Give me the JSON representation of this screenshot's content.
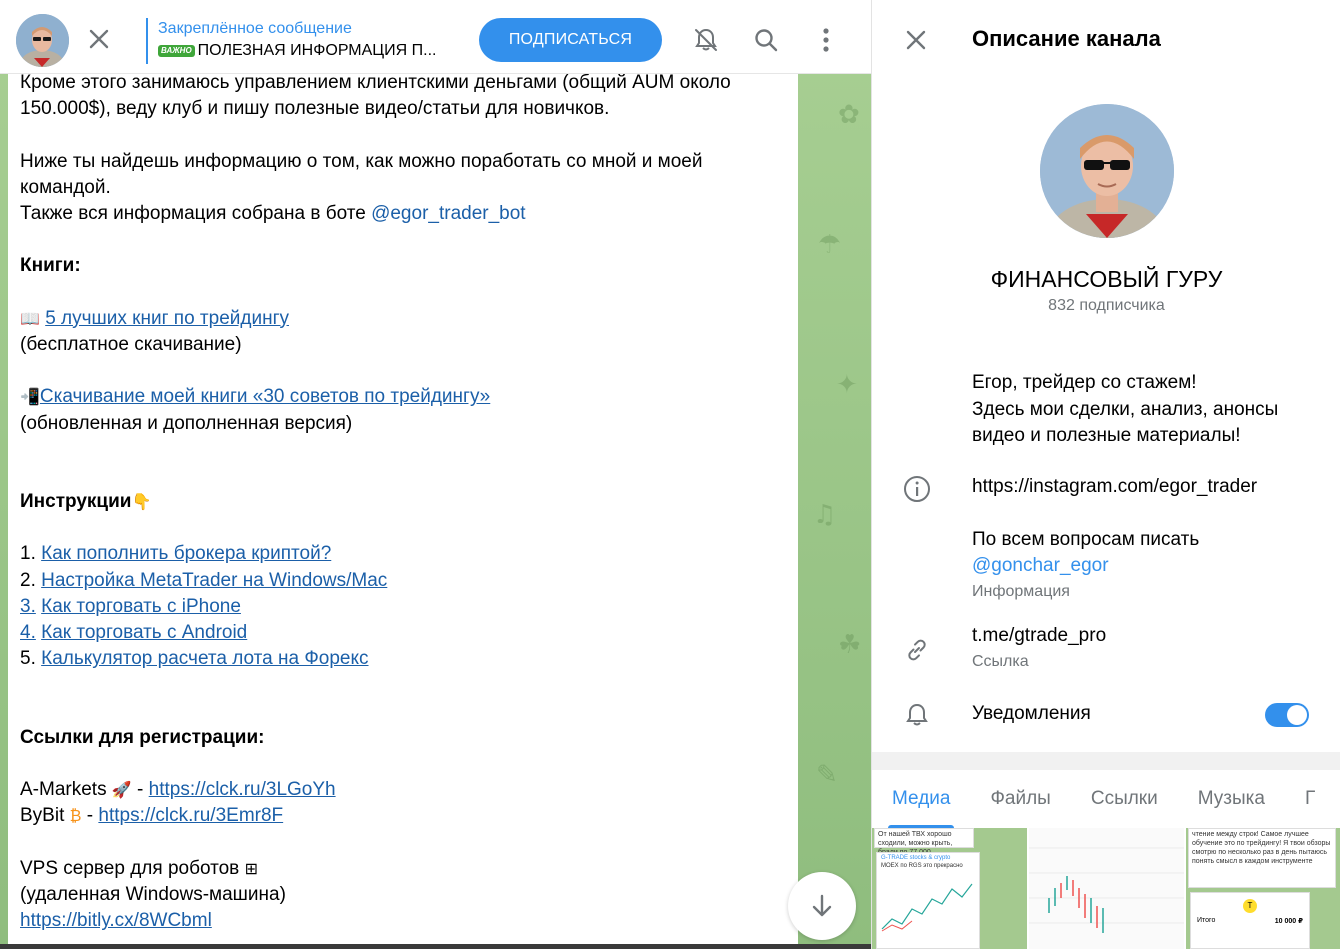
{
  "header": {
    "pinned_title": "Закреплённое сообщение",
    "pinned_badge": "ВАЖНО",
    "pinned_text": "ПОЛЕЗНАЯ ИНФОРМАЦИЯ П...",
    "subscribe_label": "ПОДПИСАТЬСЯ"
  },
  "message": {
    "intro_line": "Кроме этого занимаюсь управлением клиентскими деньгами (общий AUM около 150.000$), веду клуб и пишу полезные видео/статьи для новичков.",
    "below_line": "Ниже ты найдешь информацию о том, как можно поработать со мной и моей командой.",
    "bot_line_prefix": "Также вся информация собрана в боте ",
    "bot_mention": "@egor_trader_bot",
    "books_heading": "Книги:",
    "book1_link": "5 лучших книг по трейдингу",
    "book1_note": "(бесплатное скачивание)",
    "book2_link": "Скачивание моей книги «30 советов по трейдингу»",
    "book2_note": "(обновленная и дополненная версия)",
    "instructions_heading": "Инструкции",
    "instructions": [
      {
        "num": "1. ",
        "text": "Как пополнить брокера криптой?",
        "num_link": false
      },
      {
        "num": "2. ",
        "text": "Настройка MetaTrader на Windows/Mac",
        "num_link": false
      },
      {
        "num": "3.",
        "text": "Как торговать с iPhone",
        "num_link": true
      },
      {
        "num": "4.",
        "text": "Как торговать с Android",
        "num_link": true
      },
      {
        "num": "5. ",
        "text": "Калькулятор расчета лота на Форекс",
        "num_link": false
      }
    ],
    "reg_heading": "Ссылки для регистрации:",
    "reg1_name": "A-Markets",
    "reg1_url": "https://clck.ru/3LGoYh",
    "reg2_name": "ByBit",
    "reg2_url": "https://clck.ru/3Emr8F",
    "vps_line": "VPS сервер для роботов",
    "vps_note": "(удаленная Windows-машина)",
    "vps_url": "https://bitly.cx/8WCbml"
  },
  "panel": {
    "title": "Описание канала",
    "channel_name": "ФИНАНСОВЫЙ ГУРУ",
    "subscribers": "832 подписчика",
    "description": [
      "Егор, трейдер со стажем!",
      "Здесь мои сделки, анализ, анонсы",
      "видео и полезные материалы!"
    ],
    "info_url": "https://instagram.com/egor_trader",
    "contact_line": "По всем вопросам писать",
    "contact_mention": "@gonchar_egor",
    "info_label": "Информация",
    "link_value": "t.me/gtrade_pro",
    "link_label": "Ссылка",
    "notifications_label": "Уведомления",
    "notifications_on": true,
    "tabs": [
      "Медиа",
      "Файлы",
      "Ссылки",
      "Музыка",
      "Г"
    ],
    "media": [
      {
        "text": "От нашей ТВХ хорошо сходили, можно крыть, брали по 77.000",
        "inner": "G-TRADE stocks & crypto",
        "inner2": "MOEX по RGS это прекрасно"
      },
      {
        "text": ""
      },
      {
        "text": "чтение между строк! Самое лучшее обучение это по трейдингу! Я твои обзоры смотрю по несколько раз в день пытаюсь понять смысл в каждом инструменте",
        "total_label": "Итого",
        "total_value": "10 000 ₽"
      }
    ]
  },
  "colors": {
    "accent": "#3390ec",
    "link": "#1b5fa8",
    "muted": "#707579",
    "chat_bg": "#9cc58a"
  }
}
